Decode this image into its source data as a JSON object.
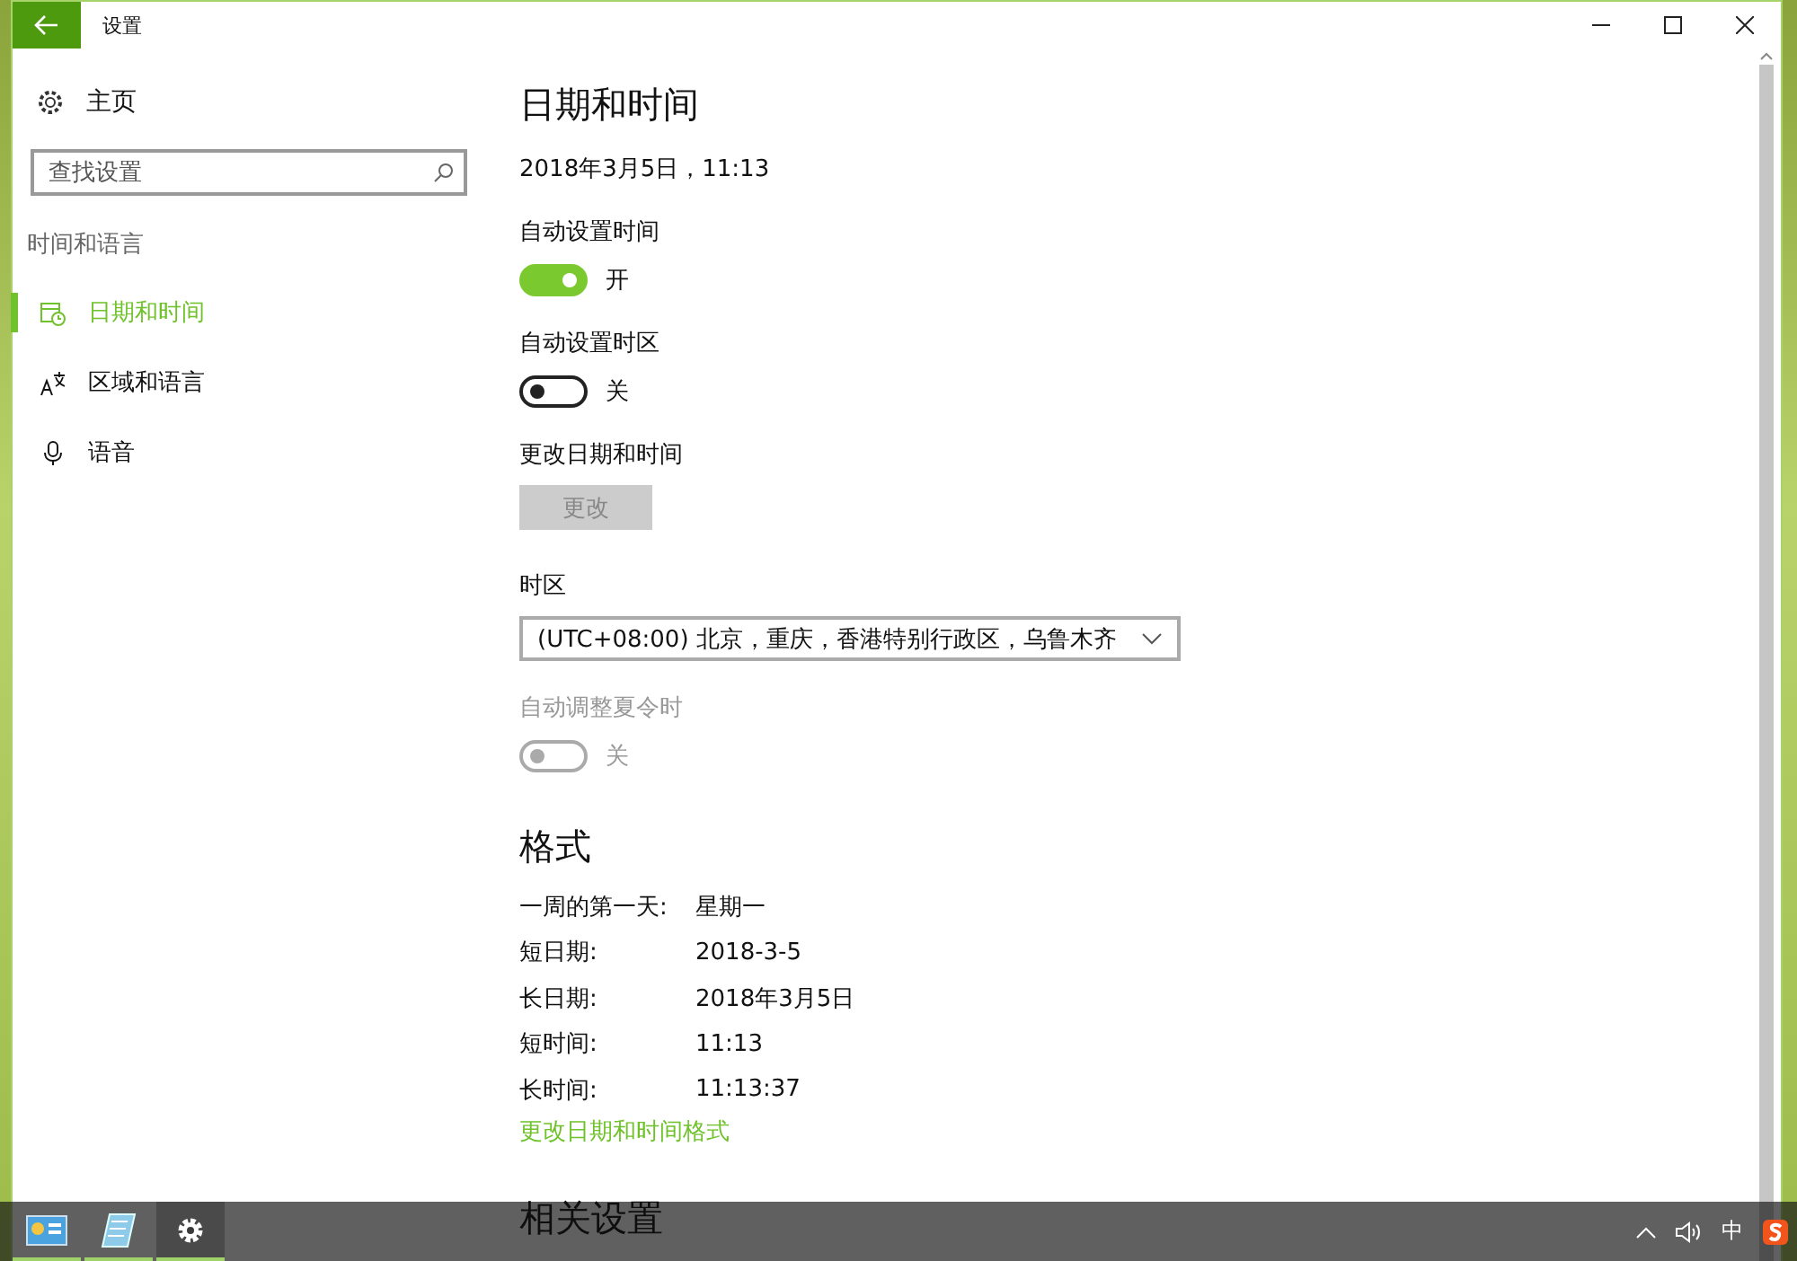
{
  "window": {
    "title": "设置"
  },
  "sidebar": {
    "home": "主页",
    "search": {
      "placeholder": "查找设置"
    },
    "section": "时间和语言",
    "items": [
      {
        "label": "日期和时间",
        "kind": "calendar-clock",
        "selected": true
      },
      {
        "label": "区域和语言",
        "kind": "language",
        "selected": false
      },
      {
        "label": "语音",
        "kind": "microphone",
        "selected": false
      }
    ]
  },
  "page": {
    "title": "日期和时间",
    "current": "2018年3月5日，11:13",
    "settings": [
      {
        "kind": "toggle",
        "label": "自动设置时间",
        "on": true,
        "state_text": "开",
        "disabled": false
      },
      {
        "kind": "toggle",
        "label": "自动设置时区",
        "on": false,
        "state_text": "关",
        "disabled": false
      },
      {
        "kind": "button",
        "label": "更改日期和时间",
        "button": "更改",
        "disabled": true
      },
      {
        "kind": "dropdown",
        "label": "时区",
        "value": "(UTC+08:00) 北京，重庆，香港特别行政区，乌鲁木齐"
      },
      {
        "kind": "toggle",
        "label": "自动调整夏令时",
        "on": false,
        "state_text": "关",
        "disabled": true
      }
    ]
  },
  "format": {
    "title": "格式",
    "rows": [
      {
        "label": "一周的第一天:",
        "value": "星期一"
      },
      {
        "label": "短日期:",
        "value": "2018-3-5"
      },
      {
        "label": "长日期:",
        "value": "2018年3月5日"
      },
      {
        "label": "短时间:",
        "value": "11:13"
      },
      {
        "label": "长时间:",
        "value": "11:13:37"
      }
    ],
    "link": "更改日期和时间格式"
  },
  "related": {
    "title": "相关设置"
  },
  "taskbar": {
    "apps": [
      {
        "kind": "control-panel",
        "selected": false
      },
      {
        "kind": "notepad",
        "selected": false
      },
      {
        "kind": "settings",
        "selected": true
      }
    ],
    "ime": "中"
  }
}
